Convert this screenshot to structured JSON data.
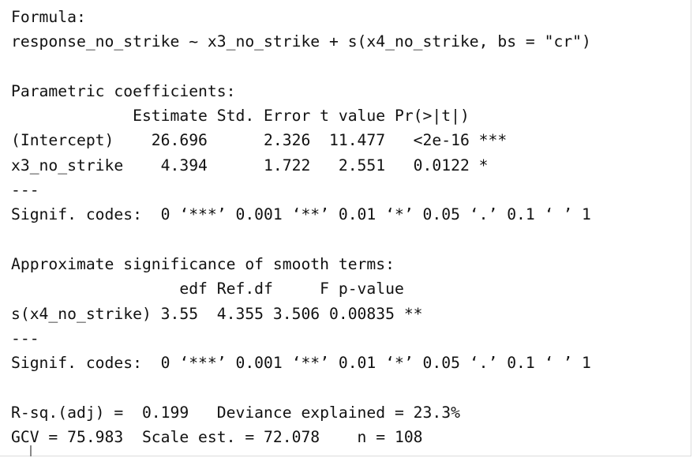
{
  "console": {
    "lines": [
      "Formula:",
      "response_no_strike ~ x3_no_strike + s(x4_no_strike, bs = \"cr\")",
      "",
      "Parametric coefficients:",
      "             Estimate Std. Error t value Pr(>|t|)    ",
      "(Intercept)    26.696      2.326  11.477   <2e-16 ***",
      "x3_no_strike    4.394      1.722   2.551   0.0122 *  ",
      "---",
      "Signif. codes:  0 ‘***’ 0.001 ‘**’ 0.01 ‘*’ 0.05 ‘.’ 0.1 ‘ ’ 1",
      "",
      "Approximate significance of smooth terms:",
      "                  edf Ref.df     F p-value   ",
      "s(x4_no_strike) 3.55  4.355 3.506 0.00835 **",
      "---",
      "Signif. codes:  0 ‘***’ 0.001 ‘**’ 0.01 ‘*’ 0.05 ‘.’ 0.1 ‘ ’ 1",
      "",
      "R-sq.(adj) =  0.199   Deviance explained = 23.3%",
      "GCV = 75.983  Scale est. = 72.078    n = 108"
    ]
  }
}
